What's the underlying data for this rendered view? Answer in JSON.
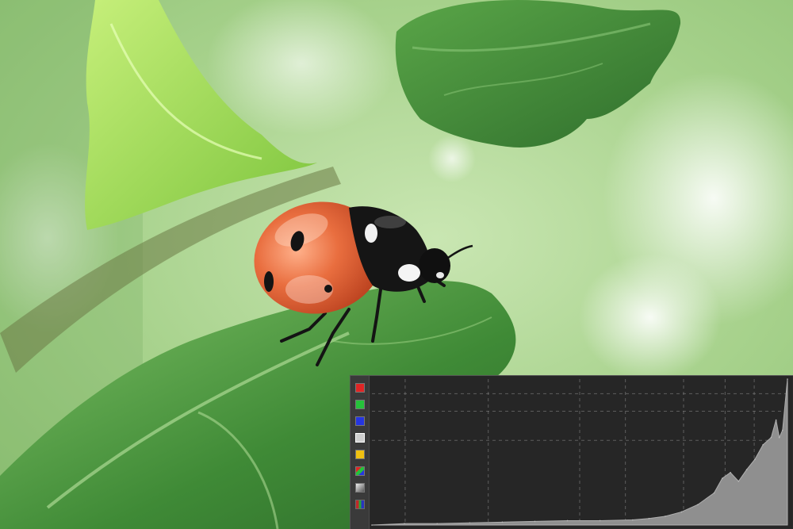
{
  "image": {
    "subject": "photo",
    "colors": {
      "background_light": "#d4eec0",
      "leaf_green": "#4f9a3e",
      "leaf_dark": "#2d6a2a",
      "ladybug_red": "#e0643a",
      "ladybug_black": "#141414"
    }
  },
  "histogram_panel": {
    "channels": [
      {
        "name": "red-channel",
        "color": "#e02525"
      },
      {
        "name": "green-channel",
        "color": "#25c23a"
      },
      {
        "name": "blue-channel",
        "color": "#2535e0"
      },
      {
        "name": "luminance-channel",
        "color": "#cfcfcf"
      },
      {
        "name": "yellow-channel",
        "color": "#f0c010"
      },
      {
        "name": "rgb-channel",
        "color": "multi"
      },
      {
        "name": "rgb-overlay-channel",
        "color": "gradient"
      },
      {
        "name": "parade-channel",
        "color": "split"
      }
    ],
    "selected_channel": "luminance-channel",
    "colors": {
      "panel_bg": "#2a2a2a",
      "plot_bg": "#262626",
      "grid": "#8a8a8a",
      "fill": "#8f8f8f"
    },
    "chart_data": {
      "type": "area",
      "title": "",
      "xlabel": "",
      "ylabel": "",
      "xlim": [
        0,
        255
      ],
      "ylim": [
        0,
        1
      ],
      "grid": true,
      "series": [
        {
          "x": [
            0,
            20,
            40,
            60,
            80,
            100,
            120,
            140,
            160,
            170,
            180,
            190,
            200,
            210,
            215,
            220,
            225,
            230,
            235,
            240,
            245,
            248,
            250,
            252,
            255
          ],
          "values": [
            0,
            0.01,
            0.01,
            0.015,
            0.02,
            0.025,
            0.03,
            0.03,
            0.035,
            0.045,
            0.06,
            0.09,
            0.14,
            0.22,
            0.32,
            0.36,
            0.3,
            0.38,
            0.45,
            0.55,
            0.6,
            0.72,
            0.6,
            0.65,
            1.0
          ]
        }
      ]
    }
  }
}
